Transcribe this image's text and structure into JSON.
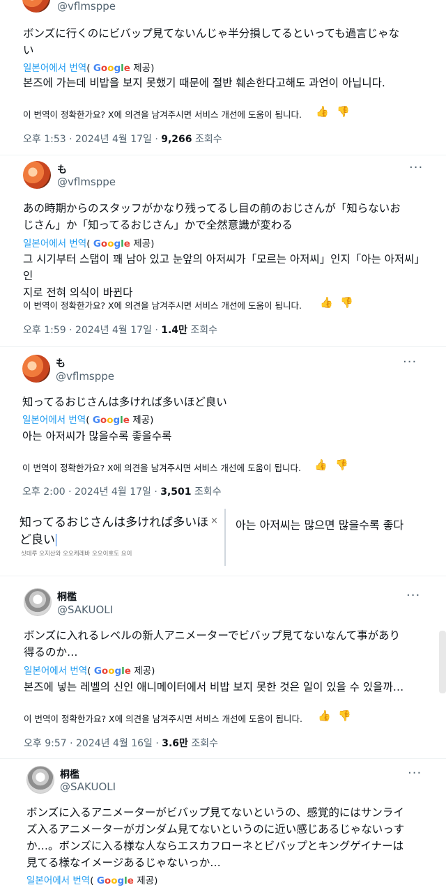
{
  "translation_label": {
    "prefix": "일본어에서 번역",
    "open_paren": "(",
    "g1": "G",
    "g2": "o",
    "g3": "o",
    "g4": "g",
    "g5": "l",
    "g6": "e",
    "provided": "제공)"
  },
  "feedback_text": "이 번역이 정확한가요? X에 의견을 남겨주시면 서비스 개선에 도움이 됩니다.",
  "posts": [
    {
      "handle": "@vflmsppe",
      "jp_lines": [
        "ボンズに行くのにビバップ見てないんじゃ半分損してるといっても過言じゃな",
        "い"
      ],
      "kr_lines": [
        "본즈에 가는데 비밥을 보지 못했기 때문에 절반 훼손한다고해도 과언이 아닙니다."
      ],
      "time": "오후 1:53 · 2024년 4월 17일 · ",
      "views": "9,266",
      "views_label": " 조회수"
    },
    {
      "name": "も",
      "handle": "@vflmsppe",
      "more": "···",
      "jp_lines": [
        "あの時期からのスタッフがかなり残ってるし目の前のおじさんが「知らないお",
        "じさん」か「知ってるおじさん」かで全然意識が変わる"
      ],
      "kr_lines": [
        "그 시기부터 스탭이 꽤 남아 있고 눈앞의 아저씨가「모르는 아저씨」인지「아는 아저씨」인",
        "지로 전혀 의식이 바뀐다"
      ],
      "time": "오후 1:59 · 2024년 4월 17일 · ",
      "views": "1.4만",
      "views_label": " 조회수"
    },
    {
      "name": "も",
      "handle": "@vflmsppe",
      "more": "···",
      "jp_lines": [
        "知ってるおじさんは多ければ多いほど良い"
      ],
      "kr_lines": [
        "아는 아저씨가 많을수록 좋을수록"
      ],
      "time": "오후 2:00 · 2024년 4월 17일 · ",
      "views": "3,501",
      "views_label": " 조회수"
    },
    {
      "name": "桐檻",
      "handle": "@SAKUOLI",
      "more": "···",
      "jp_lines": [
        "ボンズに入れるレベルの新人アニメーターでビバップ見てないなんて事があり",
        "得るのか…"
      ],
      "kr_lines": [
        "본즈에 넣는 레벨의 신인 애니메이터에서 비밥 보지 못한 것은 일이 있을 수 있을까…"
      ],
      "time": "오후 9:57 · 2024년 4월 16일 · ",
      "views": "3.6만",
      "views_label": " 조회수"
    },
    {
      "name": "桐檻",
      "handle": "@SAKUOLI",
      "more": "···",
      "jp_lines": [
        "ボンズに入るアニメーターがビバップ見てないというの、感覚的にはサンライ",
        "ズ入るアニメーターがガンダム見てないというのに近い感じあるじゃないっす",
        "か…。ボンズに入る様な人ならエスカフローネとビバップとキングゲイナーは",
        "見てる様なイメージあるじゃないっか…"
      ]
    }
  ],
  "translator_box": {
    "source_line1": "知ってるおじさんは多ければ多いほ",
    "source_line2": "ど良い",
    "romaji": "싯테루 오지산와 오오케레바 오오이호도 요이",
    "close": "×",
    "target": "아는 아저씨는 많으면 많을수록 좋다"
  }
}
